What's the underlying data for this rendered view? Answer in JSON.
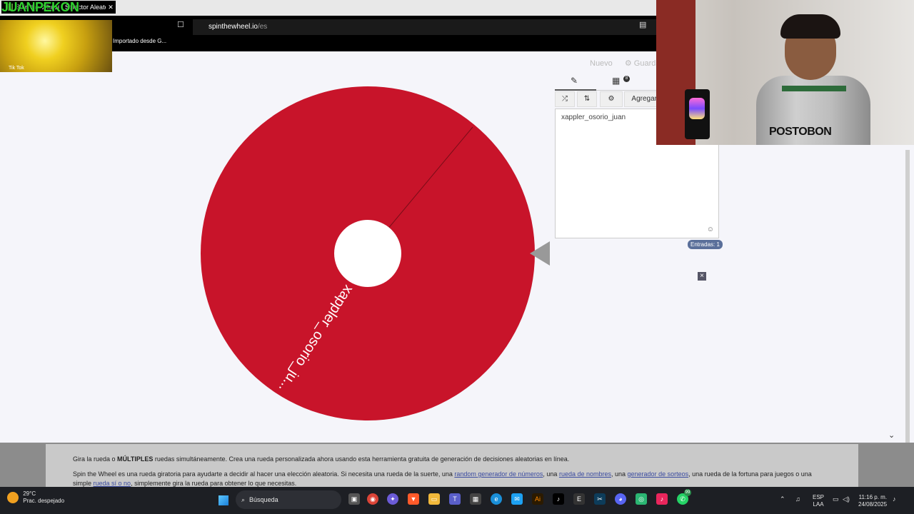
{
  "browser": {
    "tab_title": "Spin the Wheel - Selector Aleatorio Personalizado",
    "tab_close": "✕",
    "url_domain": "spinthewheel.io",
    "url_path": "/es",
    "bookmark": "Importado desde G..."
  },
  "overlay": {
    "streamer_name": "JUANPEKON",
    "thumbnail_label": "Tik Tok"
  },
  "page": {
    "top_links": [
      "Nuevo",
      "Guardar"
    ],
    "wheel_entry_label": "xappler_osorio_ju...",
    "wheel_color": "#c8142a",
    "panel": {
      "add_button": "Agregar I",
      "textarea_value": "xappler_osorio_juan",
      "badge_count": "8",
      "entries_label": "Entradas: 1"
    },
    "info": {
      "p1_a": "Gira la rueda o ",
      "p1_b": "MÚLTIPLES",
      "p1_c": " ruedas simultáneamente. Crea una rueda personalizada ahora usando esta herramienta gratuita de generación de decisiones aleatorias en línea.",
      "p2_a": "Spin the Wheel es una rueda giratoria para ayudarte a decidir al hacer una elección aleatoria. Si necesita una rueda de la suerte, una ",
      "link_numbers": "random generador de números",
      "p2_b": ", una ",
      "link_names": "rueda de nombres",
      "p2_c": ", una ",
      "link_raffle": "generador de sorteos",
      "p2_d": ", una rueda de la fortuna para juegos o una",
      "p3_a": "simple ",
      "link_yesno": "rueda sí o no",
      "p3_b": ", simplemente gira la rueda para obtener lo que necesitas."
    }
  },
  "webcam": {
    "shirt_text": "POSTOBON"
  },
  "taskbar": {
    "temperature": "29°C",
    "weather": "Prac. despejado",
    "search_placeholder": "Búsqueda",
    "lang_top": "ESP",
    "lang_bottom": "LAA",
    "time": "11:16 p. m.",
    "date": "24/08/2025",
    "notification_badge": "99"
  }
}
